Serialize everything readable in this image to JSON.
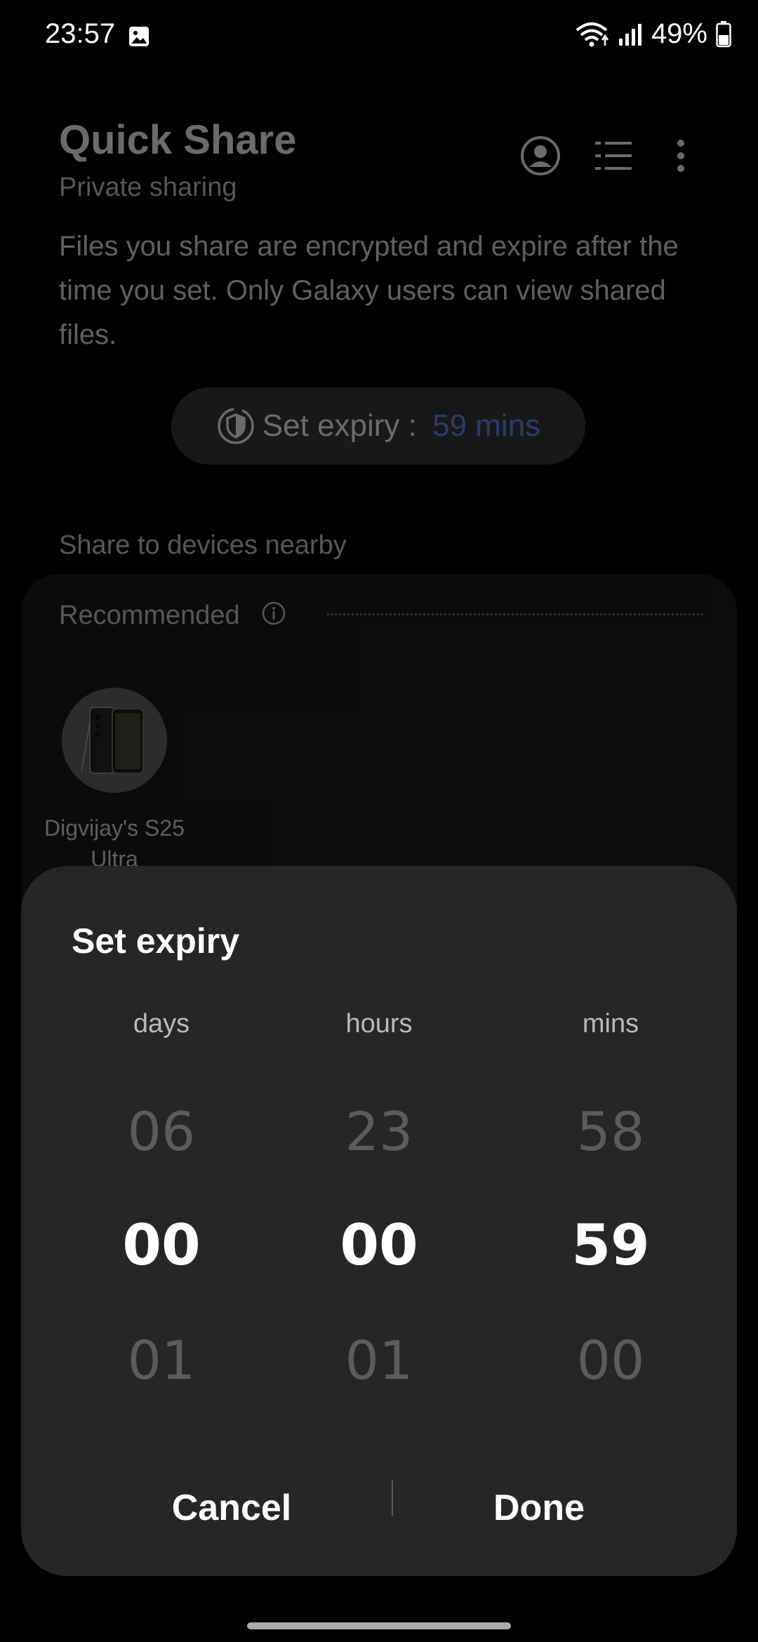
{
  "status_bar": {
    "time": "23:57",
    "battery_percent": "49%",
    "icons": [
      "gallery-icon",
      "wifi-icon",
      "signal-icon",
      "battery-icon"
    ]
  },
  "app": {
    "title": "Quick Share",
    "subtitle": "Private sharing",
    "description": "Files you share are encrypted and expire after the time you set. Only Galaxy users can view shared files.",
    "header_icons": [
      "profile-icon",
      "list-icon",
      "more-icon"
    ],
    "expiry": {
      "label": "Set expiry : ",
      "value": "59 mins"
    },
    "nearby_label": "Share to devices nearby",
    "recommended_label": "Recommended",
    "devices": [
      {
        "name": "Digvijay's S25 Ultra"
      }
    ]
  },
  "sheet": {
    "title": "Set expiry",
    "columns": [
      {
        "label": "days",
        "prev": "06",
        "current": "00",
        "next": "01"
      },
      {
        "label": "hours",
        "prev": "23",
        "current": "00",
        "next": "01"
      },
      {
        "label": "mins",
        "prev": "58",
        "current": "59",
        "next": "00"
      }
    ],
    "cancel_label": "Cancel",
    "done_label": "Done"
  },
  "colors": {
    "accent": "#6a8cff",
    "sheet_bg": "#262628",
    "background": "#000000"
  }
}
